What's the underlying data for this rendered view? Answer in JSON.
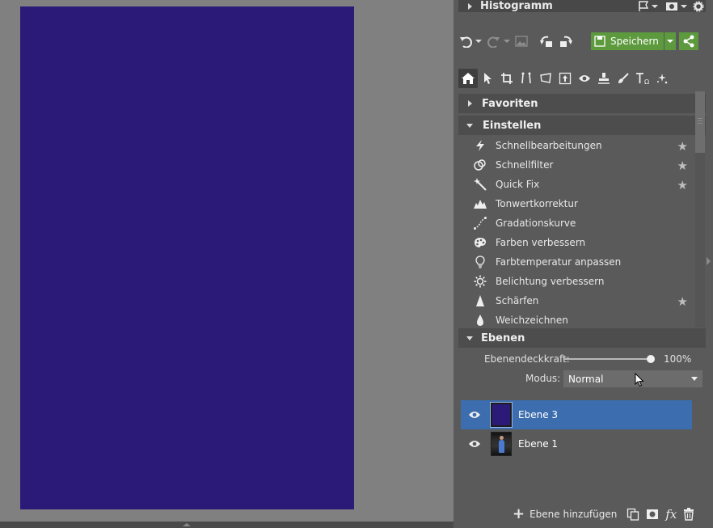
{
  "panels": {
    "histogram": {
      "title": "Histogramm"
    },
    "favorites": {
      "title": "Favoriten"
    },
    "adjust": {
      "title": "Einstellen",
      "items": [
        {
          "label": "Schnellbearbeitungen",
          "icon": "lightning-icon",
          "starred": true
        },
        {
          "label": "Schnellfilter",
          "icon": "filter-icon",
          "starred": true
        },
        {
          "label": "Quick Fix",
          "icon": "magic-wand-icon",
          "starred": true
        },
        {
          "label": "Tonwertkorrektur",
          "icon": "levels-icon",
          "starred": false
        },
        {
          "label": "Gradationskurve",
          "icon": "curve-icon",
          "starred": false
        },
        {
          "label": "Farben verbessern",
          "icon": "palette-icon",
          "starred": false
        },
        {
          "label": "Farbtemperatur anpassen",
          "icon": "bulb-icon",
          "starred": false
        },
        {
          "label": "Belichtung verbessern",
          "icon": "sun-icon",
          "starred": false
        },
        {
          "label": "Schärfen",
          "icon": "triangle-icon",
          "starred": true
        },
        {
          "label": "Weichzeichnen",
          "icon": "drop-icon",
          "starred": false
        }
      ]
    },
    "layers": {
      "title": "Ebenen",
      "opacity_label": "Ebenendeckkraft:",
      "opacity_value": "100%",
      "opacity": 1.0,
      "mode_label": "Modus:",
      "mode_value": "Normal",
      "items": [
        {
          "name": "Ebene 3",
          "selected": true
        },
        {
          "name": "Ebene 1",
          "selected": false
        }
      ],
      "add_label": "Ebene hinzufügen"
    }
  },
  "toolbar": {
    "save_label": "Speichern"
  },
  "colors": {
    "canvas_fill": "#2c1a78",
    "accent_green": "#5d9a3e",
    "selection_blue": "#3c6dae"
  }
}
